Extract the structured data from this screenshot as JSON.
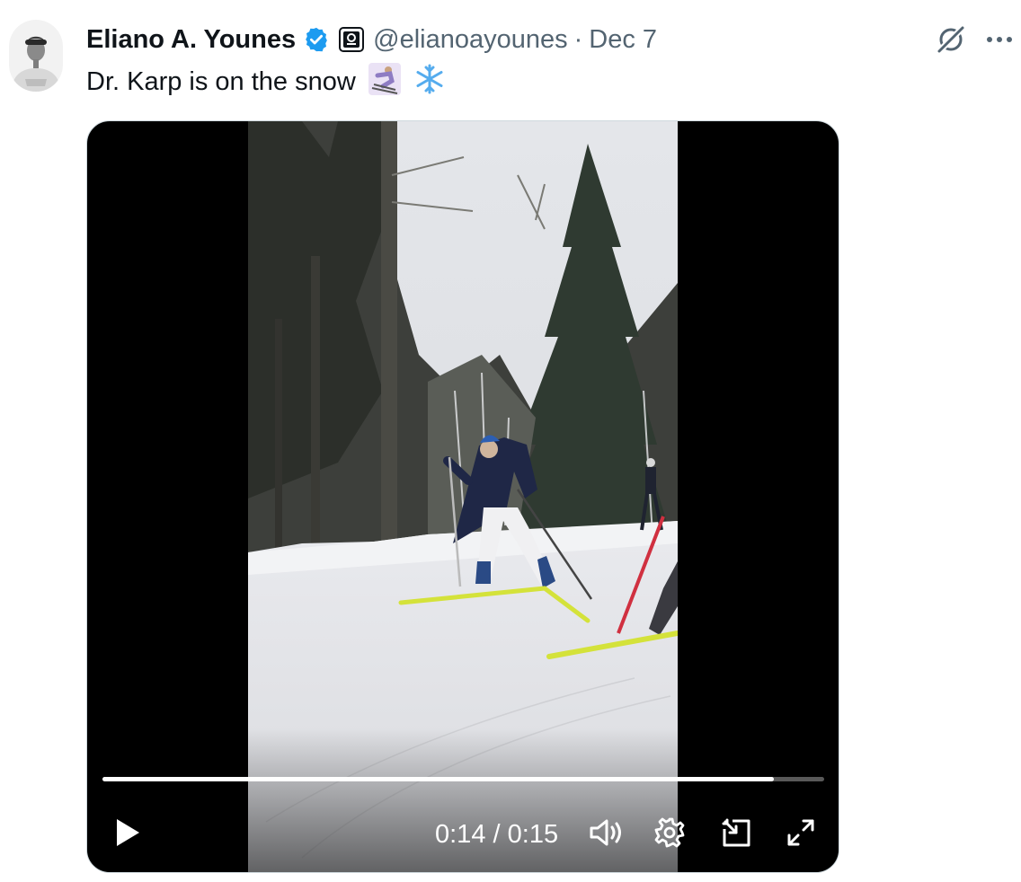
{
  "author": {
    "display_name": "Eliano A. Younes",
    "handle": "@elianoayounes",
    "separator": "·",
    "date": "Dec 7"
  },
  "tweet": {
    "text": "Dr. Karp is on the snow"
  },
  "video": {
    "current_time": "0:14",
    "time_separator": "/",
    "duration": "0:15",
    "progress_fraction": 0.93
  },
  "icons": {
    "verified": "verified-badge-icon",
    "affiliate": "affiliate-badge-icon",
    "grok": "grok-icon",
    "more": "more-icon",
    "play": "play-icon",
    "volume": "volume-icon",
    "settings": "gear-icon",
    "pip": "picture-in-picture-icon",
    "fullscreen": "fullscreen-icon"
  },
  "colors": {
    "verified": "#1d9bf0",
    "secondary_text": "#536471",
    "primary_text": "#0f1419"
  }
}
